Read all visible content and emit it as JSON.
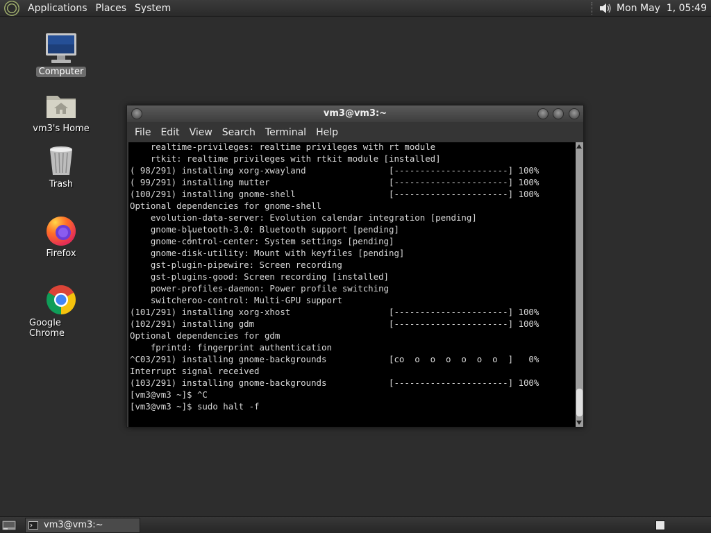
{
  "top_panel": {
    "menus": [
      "Applications",
      "Places",
      "System"
    ],
    "clock": "Mon May  1, 05:49"
  },
  "desktop_icons": [
    {
      "label": "Computer",
      "icon": "computer-icon",
      "selected": true
    },
    {
      "label": "vm3's Home",
      "icon": "home-folder-icon"
    },
    {
      "label": "Trash",
      "icon": "trash-icon"
    },
    {
      "label": "Firefox",
      "icon": "firefox-icon"
    },
    {
      "label": "Google Chrome",
      "icon": "chrome-icon"
    }
  ],
  "terminal": {
    "title": "vm3@vm3:~",
    "menu": [
      "File",
      "Edit",
      "View",
      "Search",
      "Terminal",
      "Help"
    ],
    "lines": [
      "    realtime-privileges: realtime privileges with rt module",
      "    rtkit: realtime privileges with rtkit module [installed]",
      "( 98/291) installing xorg-xwayland                [----------------------] 100%",
      "( 99/291) installing mutter                       [----------------------] 100%",
      "(100/291) installing gnome-shell                  [----------------------] 100%",
      "Optional dependencies for gnome-shell",
      "    evolution-data-server: Evolution calendar integration [pending]",
      "    gnome-bluetooth-3.0: Bluetooth support [pending]",
      "    gnome-control-center: System settings [pending]",
      "    gnome-disk-utility: Mount with keyfiles [pending]",
      "    gst-plugin-pipewire: Screen recording",
      "    gst-plugins-good: Screen recording [installed]",
      "    power-profiles-daemon: Power profile switching",
      "    switcheroo-control: Multi-GPU support",
      "(101/291) installing xorg-xhost                   [----------------------] 100%",
      "(102/291) installing gdm                          [----------------------] 100%",
      "Optional dependencies for gdm",
      "    fprintd: fingerprint authentication",
      "^C03/291) installing gnome-backgrounds            [co  o  o  o  o  o  o  ]   0%",
      "Interrupt signal received",
      "(103/291) installing gnome-backgrounds            [----------------------] 100%",
      "[vm3@vm3 ~]$ ^C",
      "[vm3@vm3 ~]$ sudo halt -f"
    ]
  },
  "taskbar": {
    "window_label": "vm3@vm3:~"
  },
  "colors": {
    "desktop_bg": "#2d2d2d",
    "terminal_bg": "#000000",
    "terminal_fg": "#d8d8d8"
  }
}
